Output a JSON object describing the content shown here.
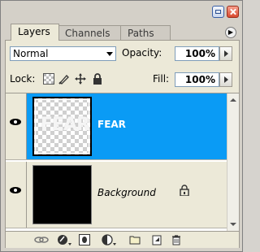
{
  "tabs": [
    {
      "label": "Layers",
      "active": true
    },
    {
      "label": "Channels",
      "active": false
    },
    {
      "label": "Paths",
      "active": false
    }
  ],
  "controls": {
    "blend_mode": "Normal",
    "opacity_label": "Opacity:",
    "opacity_value": "100%",
    "lock_label": "Lock:",
    "fill_label": "Fill:",
    "fill_value": "100%"
  },
  "layers": [
    {
      "name": "FEAR",
      "thumbnail_text": "FEAR",
      "selected": true,
      "visible": true
    },
    {
      "name": "Background",
      "selected": false,
      "visible": true,
      "locked": true
    }
  ],
  "colors": {
    "selected_row": "#0a9bf5",
    "panel_bg": "#ece9d8",
    "close_button": "#d8482d"
  },
  "icons": [
    "minimize-icon",
    "close-icon",
    "panel-menu-icon",
    "lock-transparency-icon",
    "lock-paint-icon",
    "lock-move-icon",
    "lock-all-icon",
    "eye-icon",
    "lock-icon",
    "link-icon",
    "layer-style-icon",
    "layer-mask-icon",
    "adjustment-layer-icon",
    "new-group-icon",
    "new-layer-icon",
    "trash-icon"
  ]
}
